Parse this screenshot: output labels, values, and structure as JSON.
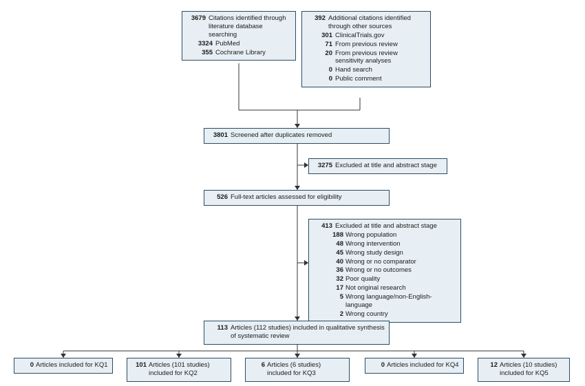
{
  "chart_data": {
    "type": "flow-diagram",
    "nodes": [
      {
        "id": "identified",
        "value": 3679,
        "label": "Citations identified through literature database searching",
        "sub": [
          {
            "value": 3324,
            "label": "PubMed"
          },
          {
            "value": 355,
            "label": "Cochrane Library"
          }
        ]
      },
      {
        "id": "additional",
        "value": 392,
        "label": "Additional citations identified through other sources",
        "sub": [
          {
            "value": 301,
            "label": "ClinicalTrials.gov"
          },
          {
            "value": 71,
            "label": "From previous review"
          },
          {
            "value": 20,
            "label": "From previous review sensitivity analyses"
          },
          {
            "value": 0,
            "label": "Hand search"
          },
          {
            "value": 0,
            "label": "Public comment"
          }
        ]
      },
      {
        "id": "screened",
        "value": 3801,
        "label": "Screened after duplicates removed"
      },
      {
        "id": "excluded_title_abstract",
        "value": 3275,
        "label": "Excluded at title and abstract stage"
      },
      {
        "id": "fulltext",
        "value": 526,
        "label": "Full-text articles assessed for eligibility"
      },
      {
        "id": "excluded_fulltext",
        "value": 413,
        "label": "Excluded at title and abstract stage",
        "sub": [
          {
            "value": 188,
            "label": "Wrong population"
          },
          {
            "value": 48,
            "label": "Wrong intervention"
          },
          {
            "value": 45,
            "label": "Wrong study design"
          },
          {
            "value": 40,
            "label": "Wrong or no comparator"
          },
          {
            "value": 36,
            "label": "Wrong or no outcomes"
          },
          {
            "value": 32,
            "label": "Poor quality"
          },
          {
            "value": 17,
            "label": "Not original research"
          },
          {
            "value": 5,
            "label": "Wrong language/non-English-language"
          },
          {
            "value": 2,
            "label": "Wrong country"
          }
        ]
      },
      {
        "id": "included",
        "value": 113,
        "label": "Articles (112 studies) included in qualitative synthesis of systematic review"
      },
      {
        "id": "kq1",
        "value": 0,
        "label": "Articles included for KQ1"
      },
      {
        "id": "kq2",
        "value": 101,
        "label": "Articles (101 studies) included for KQ2"
      },
      {
        "id": "kq3",
        "value": 6,
        "label": "Articles (6 studies) included for KQ3"
      },
      {
        "id": "kq4",
        "value": 0,
        "label": "Articles included for KQ4"
      },
      {
        "id": "kq5",
        "value": 12,
        "label": "Articles (10 studies) included for KQ5"
      }
    ]
  }
}
